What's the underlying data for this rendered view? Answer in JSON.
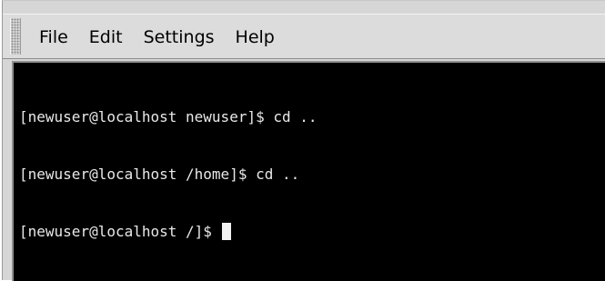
{
  "menubar": {
    "items": [
      {
        "label": "File"
      },
      {
        "label": "Edit"
      },
      {
        "label": "Settings"
      },
      {
        "label": "Help"
      }
    ]
  },
  "terminal": {
    "lines": [
      {
        "text": "[newuser@localhost newuser]$ cd .."
      },
      {
        "text": "[newuser@localhost /home]$ cd .."
      },
      {
        "text": "[newuser@localhost /]$ "
      }
    ],
    "colors": {
      "background": "#000000",
      "foreground": "#e8e8e8",
      "cursor": "#f2f2f2"
    }
  }
}
